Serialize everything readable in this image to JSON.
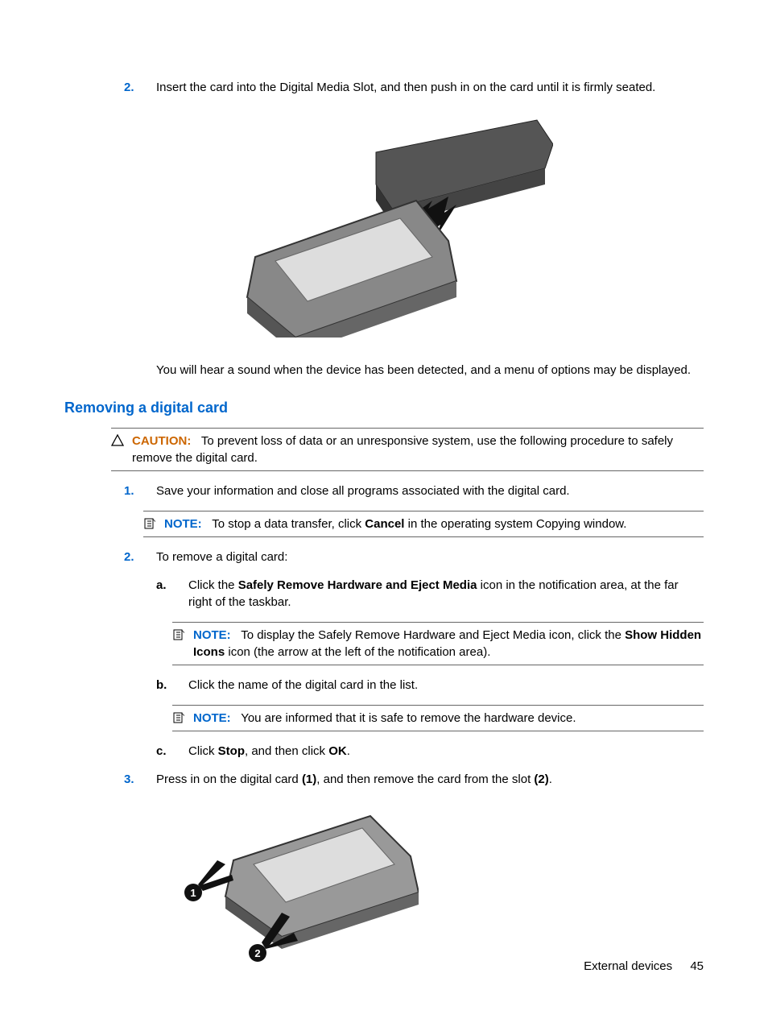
{
  "step2": {
    "num": "2.",
    "text": "Insert the card into the Digital Media Slot, and then push in on the card until it is firmly seated."
  },
  "afterImage1": "You will hear a sound when the device has been detected, and a menu of options may be displayed.",
  "heading": "Removing a digital card",
  "caution": {
    "label": "CAUTION:",
    "text": "To prevent loss of data or an unresponsive system, use the following procedure to safely remove the digital card."
  },
  "r_step1": {
    "num": "1.",
    "text": "Save your information and close all programs associated with the digital card."
  },
  "r_note1": {
    "label": "NOTE:",
    "pre": "To stop a data transfer, click ",
    "bold": "Cancel",
    "post": " in the operating system Copying window."
  },
  "r_step2": {
    "num": "2.",
    "text": "To remove a digital card:"
  },
  "r_step2a": {
    "num": "a.",
    "pre": "Click the ",
    "bold": "Safely Remove Hardware and Eject Media",
    "post": " icon in the notification area, at the far right of the taskbar."
  },
  "r_note2": {
    "label": "NOTE:",
    "pre": "To display the Safely Remove Hardware and Eject Media icon, click the ",
    "bold": "Show Hidden Icons",
    "post": " icon (the arrow at the left of the notification area)."
  },
  "r_step2b": {
    "num": "b.",
    "text": "Click the name of the digital card in the list."
  },
  "r_note3": {
    "label": "NOTE:",
    "text": "You are informed that it is safe to remove the hardware device."
  },
  "r_step2c": {
    "num": "c.",
    "pre": "Click ",
    "bold1": "Stop",
    "mid": ", and then click ",
    "bold2": "OK",
    "post": "."
  },
  "r_step3": {
    "num": "3.",
    "pre": "Press in on the digital card ",
    "bold1": "(1)",
    "mid": ", and then remove the card from the slot ",
    "bold2": "(2)",
    "post": "."
  },
  "footer": {
    "section": "External devices",
    "page": "45"
  }
}
